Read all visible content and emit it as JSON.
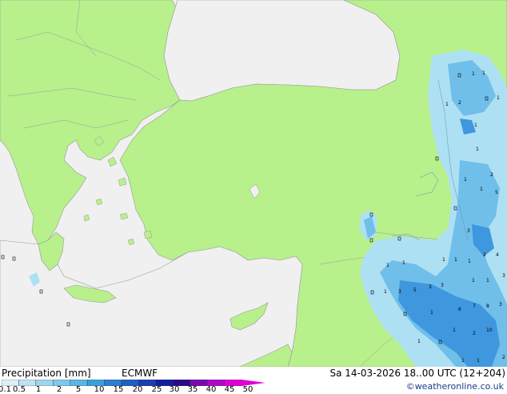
{
  "footer": {
    "title": "Precipitation [mm]",
    "model": "ECMWF",
    "valid_time": "Sa 14-03-2026 18..00 UTC (12+204)",
    "credit": "©weatheronline.co.uk"
  },
  "legend": {
    "ticks": [
      "0.1",
      "0.5",
      "1",
      "2",
      "5",
      "10",
      "15",
      "20",
      "25",
      "30",
      "35",
      "40",
      "45",
      "50"
    ],
    "colors": [
      "#dfeff8",
      "#bfe2f3",
      "#9fd4ee",
      "#7ec8ea",
      "#5ab6e4",
      "#3aa0dc",
      "#2a7fd0",
      "#1f5fc2",
      "#1a3fae",
      "#12219a",
      "#2a0a8a",
      "#7a0ab0",
      "#b00ac8",
      "#e000d8"
    ]
  },
  "map_colors": {
    "sea": "#f0f0f0",
    "land": "#b8f08c",
    "border": "#999999",
    "precip_light": "#aee0f3",
    "precip_mid": "#6fbfea",
    "precip_heavy": "#3f97de"
  },
  "precip_labels": [
    {
      "id": "p1",
      "text": "1"
    },
    {
      "id": "p2",
      "text": "1"
    },
    {
      "id": "p3",
      "text": "2"
    },
    {
      "id": "p4",
      "text": "1"
    },
    {
      "id": "p5",
      "text": "1"
    },
    {
      "id": "p6",
      "text": "1"
    },
    {
      "id": "p7",
      "text": "1"
    },
    {
      "id": "p8",
      "text": "2"
    },
    {
      "id": "p9",
      "text": "1"
    },
    {
      "id": "p10",
      "text": "3"
    },
    {
      "id": "p11",
      "text": "2"
    },
    {
      "id": "p12",
      "text": "4"
    },
    {
      "id": "p13",
      "text": "1"
    },
    {
      "id": "p14",
      "text": "1"
    },
    {
      "id": "p15",
      "text": "1"
    },
    {
      "id": "p16",
      "text": "3"
    },
    {
      "id": "p17",
      "text": "5"
    },
    {
      "id": "p18",
      "text": "1"
    },
    {
      "id": "p19",
      "text": "3"
    },
    {
      "id": "p20",
      "text": "3"
    },
    {
      "id": "p21",
      "text": "1"
    },
    {
      "id": "p22",
      "text": "1"
    },
    {
      "id": "p23",
      "text": "6"
    },
    {
      "id": "p24",
      "text": "7"
    },
    {
      "id": "p25",
      "text": "8"
    },
    {
      "id": "p26",
      "text": "3"
    },
    {
      "id": "p27",
      "text": "2"
    },
    {
      "id": "p28",
      "text": "10"
    },
    {
      "id": "p29",
      "text": "1"
    },
    {
      "id": "p30",
      "text": "1"
    },
    {
      "id": "p31",
      "text": "1"
    },
    {
      "id": "p32",
      "text": "1"
    },
    {
      "id": "p33",
      "text": "2"
    },
    {
      "id": "p34",
      "text": "3"
    },
    {
      "id": "p35",
      "text": "1"
    },
    {
      "id": "p36",
      "text": "1"
    },
    {
      "id": "p37",
      "text": "5"
    },
    {
      "id": "p38",
      "text": "1"
    },
    {
      "id": "p39",
      "text": "1"
    }
  ]
}
